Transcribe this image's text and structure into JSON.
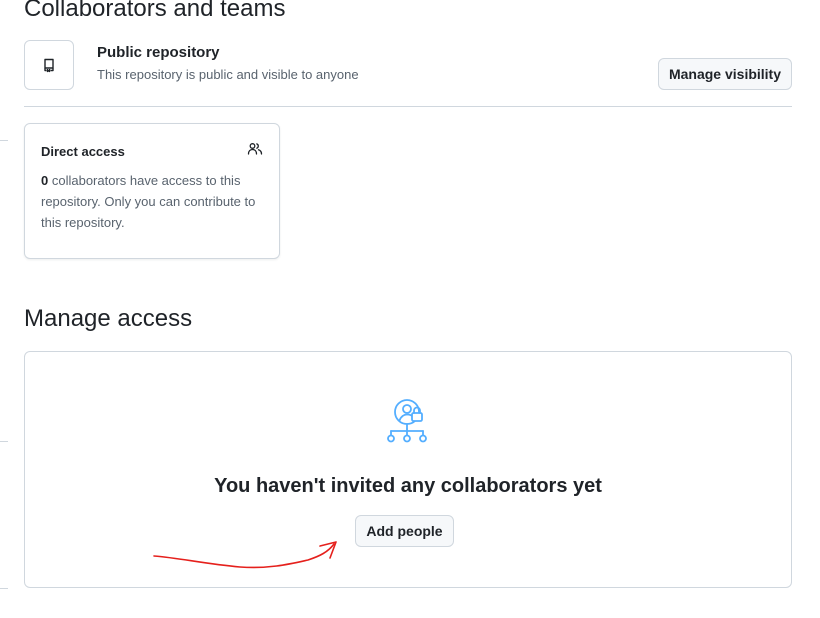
{
  "collaborators_section": {
    "heading": "Collaborators and teams",
    "visibility": {
      "icon": "repo-icon",
      "title": "Public repository",
      "description": "This repository is public and visible to anyone",
      "manage_button_label": "Manage visibility"
    },
    "direct_access": {
      "title": "Direct access",
      "icon": "people-icon",
      "count": "0",
      "body_text": " collaborators have access to this repository. Only you can contribute to this repository."
    }
  },
  "manage_access_section": {
    "heading": "Manage access",
    "empty_state": {
      "icon": "collaborators-lock-illustration-icon",
      "title": "You haven't invited any collaborators yet",
      "add_button_label": "Add people"
    }
  },
  "annotation": {
    "color": "#e5201c",
    "icon": "red-hand-drawn-arrow"
  },
  "colors": {
    "border": "#d0d7de",
    "button_bg": "#f6f8fa",
    "muted_text": "#59636e",
    "illustration_blue": "#54aeff"
  }
}
